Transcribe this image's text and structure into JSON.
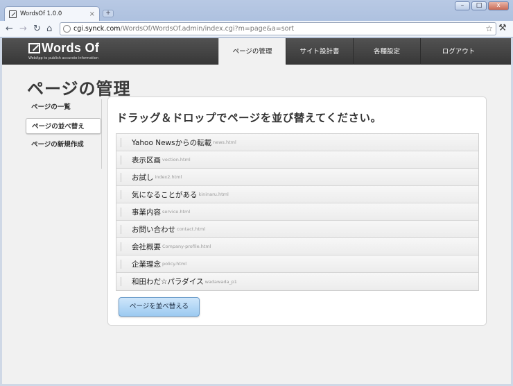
{
  "browser": {
    "tab_title": "WordsOf 1.0.0",
    "tab_close": "×",
    "new_tab": "+",
    "url_host": "cgi.synck.com",
    "url_path": "/WordsOf/WordsOf.admin/index.cgi?m=page&a=sort",
    "window_controls": {
      "minimize": "–",
      "maximize": "□",
      "close": "x"
    }
  },
  "site": {
    "logo": "Words Of",
    "tagline": "WebApp to publish accurate information"
  },
  "topnav": [
    {
      "label": "ページの管理",
      "active": true
    },
    {
      "label": "サイト設計書",
      "active": false
    },
    {
      "label": "各種設定",
      "active": false
    },
    {
      "label": "ログアウト",
      "active": false
    }
  ],
  "page_title": "ページの管理",
  "sidebar": [
    {
      "label": "ページの一覧",
      "active": false
    },
    {
      "label": "ページの並べ替え",
      "active": true
    },
    {
      "label": "ページの新規作成",
      "active": false
    }
  ],
  "panel": {
    "heading": "ドラッグ＆ドロップでページを並び替えてください。",
    "items": [
      {
        "title": "Yahoo Newsからの転載",
        "file": "news.html"
      },
      {
        "title": "表示区画",
        "file": "vection.html"
      },
      {
        "title": "お試し",
        "file": "index2.html"
      },
      {
        "title": "気になることがある",
        "file": "kininaru.html"
      },
      {
        "title": "事業内容",
        "file": "service.html"
      },
      {
        "title": "お問い合わせ",
        "file": "contact.html"
      },
      {
        "title": "会社概要",
        "file": "Company-profile.html"
      },
      {
        "title": "企業理念",
        "file": "policy.html"
      },
      {
        "title": "和田わだ☆パラダイス",
        "file": "wadawada_p1"
      }
    ],
    "button_label": "ページを並べ替える"
  }
}
